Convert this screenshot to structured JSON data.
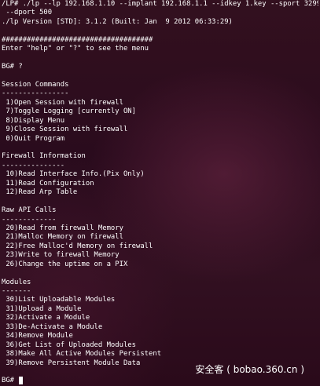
{
  "terminal": {
    "lines": [
      "/LP# ./lp --lp 192.168.1.10 --implant 192.168.1.1 --idkey 1.key --sport 3299",
      " --dport 500",
      "./lp Version [STD]: 3.1.2 (Built: Jan  9 2012 06:33:29)",
      "",
      "####################################",
      "Enter \"help\" or \"?\" to see the menu",
      "",
      "BG# ?",
      "",
      "Session Commands",
      "----------------",
      " 1)Open Session with firewall",
      " 7)Toggle Logging [currently ON]",
      " 8)Display Menu",
      " 9)Close Session with firewall",
      " 0)Quit Program",
      "",
      "Firewall Information",
      "---------------",
      " 10)Read Interface Info.(Pix Only)",
      " 11)Read Configuration",
      " 12)Read Arp Table",
      "",
      "Raw API Calls",
      "-------------",
      " 20)Read from firewall Memory",
      " 21)Malloc Memory on firewall",
      " 22)Free Malloc'd Memory on firewall",
      " 23)Write to firewall Memory",
      " 26)Change the uptime on a PIX",
      "",
      "Modules",
      "-------",
      " 30)List Uploadable Modules",
      " 31)Upload a Module",
      " 32)Activate a Module",
      " 33)De-Activate a Module",
      " 34)Remove Module",
      " 36)Get List of Uploaded Modules",
      " 38)Make All Active Modules Persistent",
      " 39)Remove Persistent Module Data"
    ],
    "prompt": "BG# "
  },
  "watermark": "安全客 ( bobao.360.cn )"
}
